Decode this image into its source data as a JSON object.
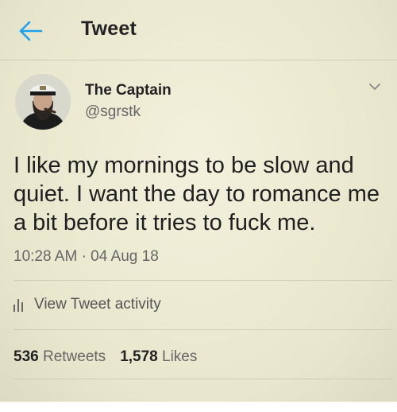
{
  "header": {
    "title": "Tweet",
    "back_icon": "back-arrow-icon"
  },
  "tweet": {
    "author_name": "The Captain",
    "author_handle": "@sgrstk",
    "text": "I like my mornings to be slow and quiet. I want the day to romance me a bit before it tries to fuck me.",
    "time": "10:28 AM",
    "separator": "·",
    "date": "04 Aug 18",
    "activity_label": "View Tweet activity",
    "retweets_count": "536",
    "retweets_label": "Retweets",
    "likes_count": "1,578",
    "likes_label": "Likes"
  },
  "colors": {
    "accent": "#1da1f2",
    "background": "#edebd2",
    "text": "#1f1f1f",
    "muted": "#666666"
  }
}
